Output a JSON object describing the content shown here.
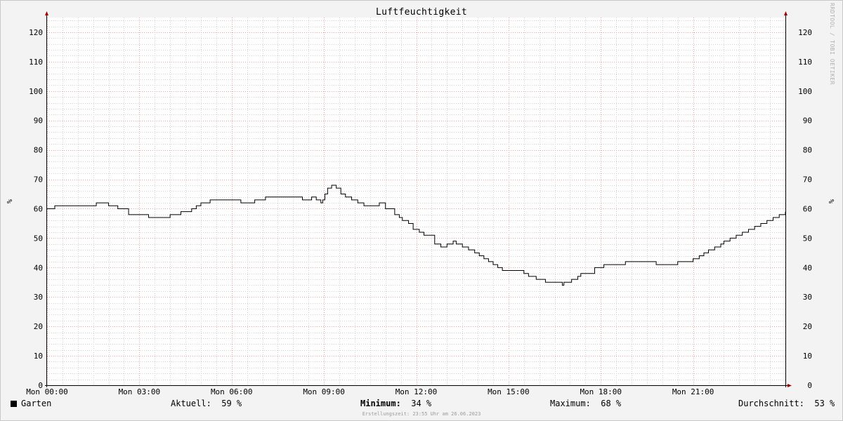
{
  "chart_data": {
    "type": "line",
    "title": "Luftfeuchtigkeit",
    "ylabel": "%",
    "ylabel_right": "%",
    "ylim": [
      0,
      125
    ],
    "y_ticks": [
      0,
      10,
      20,
      30,
      40,
      50,
      60,
      70,
      80,
      90,
      100,
      110,
      120
    ],
    "x_unit": "hours",
    "xlim": [
      0,
      24
    ],
    "x_ticks": [
      {
        "x": 0,
        "label": "Mon 00:00"
      },
      {
        "x": 3,
        "label": "Mon 03:00"
      },
      {
        "x": 6,
        "label": "Mon 06:00"
      },
      {
        "x": 9,
        "label": "Mon 09:00"
      },
      {
        "x": 12,
        "label": "Mon 12:00"
      },
      {
        "x": 15,
        "label": "Mon 15:00"
      },
      {
        "x": 18,
        "label": "Mon 18:00"
      },
      {
        "x": 21,
        "label": "Mon 21:00"
      }
    ],
    "grid": true,
    "series": [
      {
        "name": "Garten",
        "color": "#000000",
        "x": [
          0,
          0.25,
          1.0,
          1.6,
          1.75,
          2.0,
          2.3,
          2.45,
          2.65,
          3.3,
          3.45,
          4.0,
          4.2,
          4.35,
          4.5,
          4.7,
          4.85,
          5.0,
          5.3,
          5.55,
          6.3,
          6.55,
          6.75,
          7.1,
          8.1,
          8.3,
          8.6,
          8.75,
          8.9,
          8.96,
          9.03,
          9.12,
          9.25,
          9.4,
          9.55,
          9.7,
          9.9,
          10.1,
          10.3,
          10.45,
          10.6,
          10.8,
          11.0,
          11.3,
          11.45,
          11.55,
          11.75,
          11.9,
          12.1,
          12.25,
          12.4,
          12.6,
          12.8,
          13.0,
          13.2,
          13.3,
          13.5,
          13.7,
          13.9,
          14.05,
          14.2,
          14.35,
          14.5,
          14.65,
          14.8,
          15.0,
          15.15,
          15.5,
          15.65,
          15.9,
          16.0,
          16.2,
          16.5,
          16.75,
          16.8,
          16.85,
          17.05,
          17.25,
          17.35,
          17.5,
          17.8,
          18.1,
          18.5,
          18.8,
          19.2,
          19.8,
          20.0,
          20.5,
          20.6,
          21.0,
          21.2,
          21.35,
          21.5,
          21.7,
          21.9,
          22.0,
          22.2,
          22.4,
          22.6,
          22.8,
          23.0,
          23.2,
          23.4,
          23.6,
          23.8,
          24.0
        ],
        "values": [
          60,
          61,
          61,
          62,
          62,
          61,
          60,
          60,
          58,
          57,
          57,
          58,
          58,
          59,
          59,
          60,
          61,
          62,
          63,
          63,
          62,
          62,
          63,
          64,
          64,
          63,
          64,
          63,
          62,
          63,
          65,
          67,
          68,
          67,
          65,
          64,
          63,
          62,
          61,
          61,
          61,
          62,
          60,
          58,
          57,
          56,
          55,
          53,
          52,
          51,
          51,
          48,
          47,
          48,
          49,
          48,
          47,
          46,
          45,
          44,
          43,
          42,
          41,
          40,
          39,
          39,
          39,
          38,
          37,
          36,
          36,
          35,
          35,
          34,
          35,
          35,
          36,
          37,
          38,
          38,
          40,
          41,
          41,
          42,
          42,
          41,
          41,
          42,
          42,
          43,
          44,
          45,
          46,
          47,
          48,
          49,
          50,
          51,
          52,
          53,
          54,
          55,
          56,
          57,
          58,
          59
        ]
      }
    ]
  },
  "legend": {
    "series_label": "Garten",
    "current_label": "Aktuell:",
    "current_value": "59 %",
    "min_label": "Minimum:",
    "min_value": "34 %",
    "max_label": "Maximum:",
    "max_value": "68 %",
    "avg_label": "Durchschnitt:",
    "avg_value": "53 %"
  },
  "footer": "Erstellungszeit: 23:55 Uhr am 26.06.2023",
  "watermark": "RRDTOOL / TOBI OETIKER",
  "colors": {
    "major_grid": "#e8a0a0",
    "minor_grid": "#d0d0d0",
    "axis": "#000000",
    "arrow": "#a00000",
    "canvas": "#ffffff",
    "background": "#f3f3f3"
  }
}
